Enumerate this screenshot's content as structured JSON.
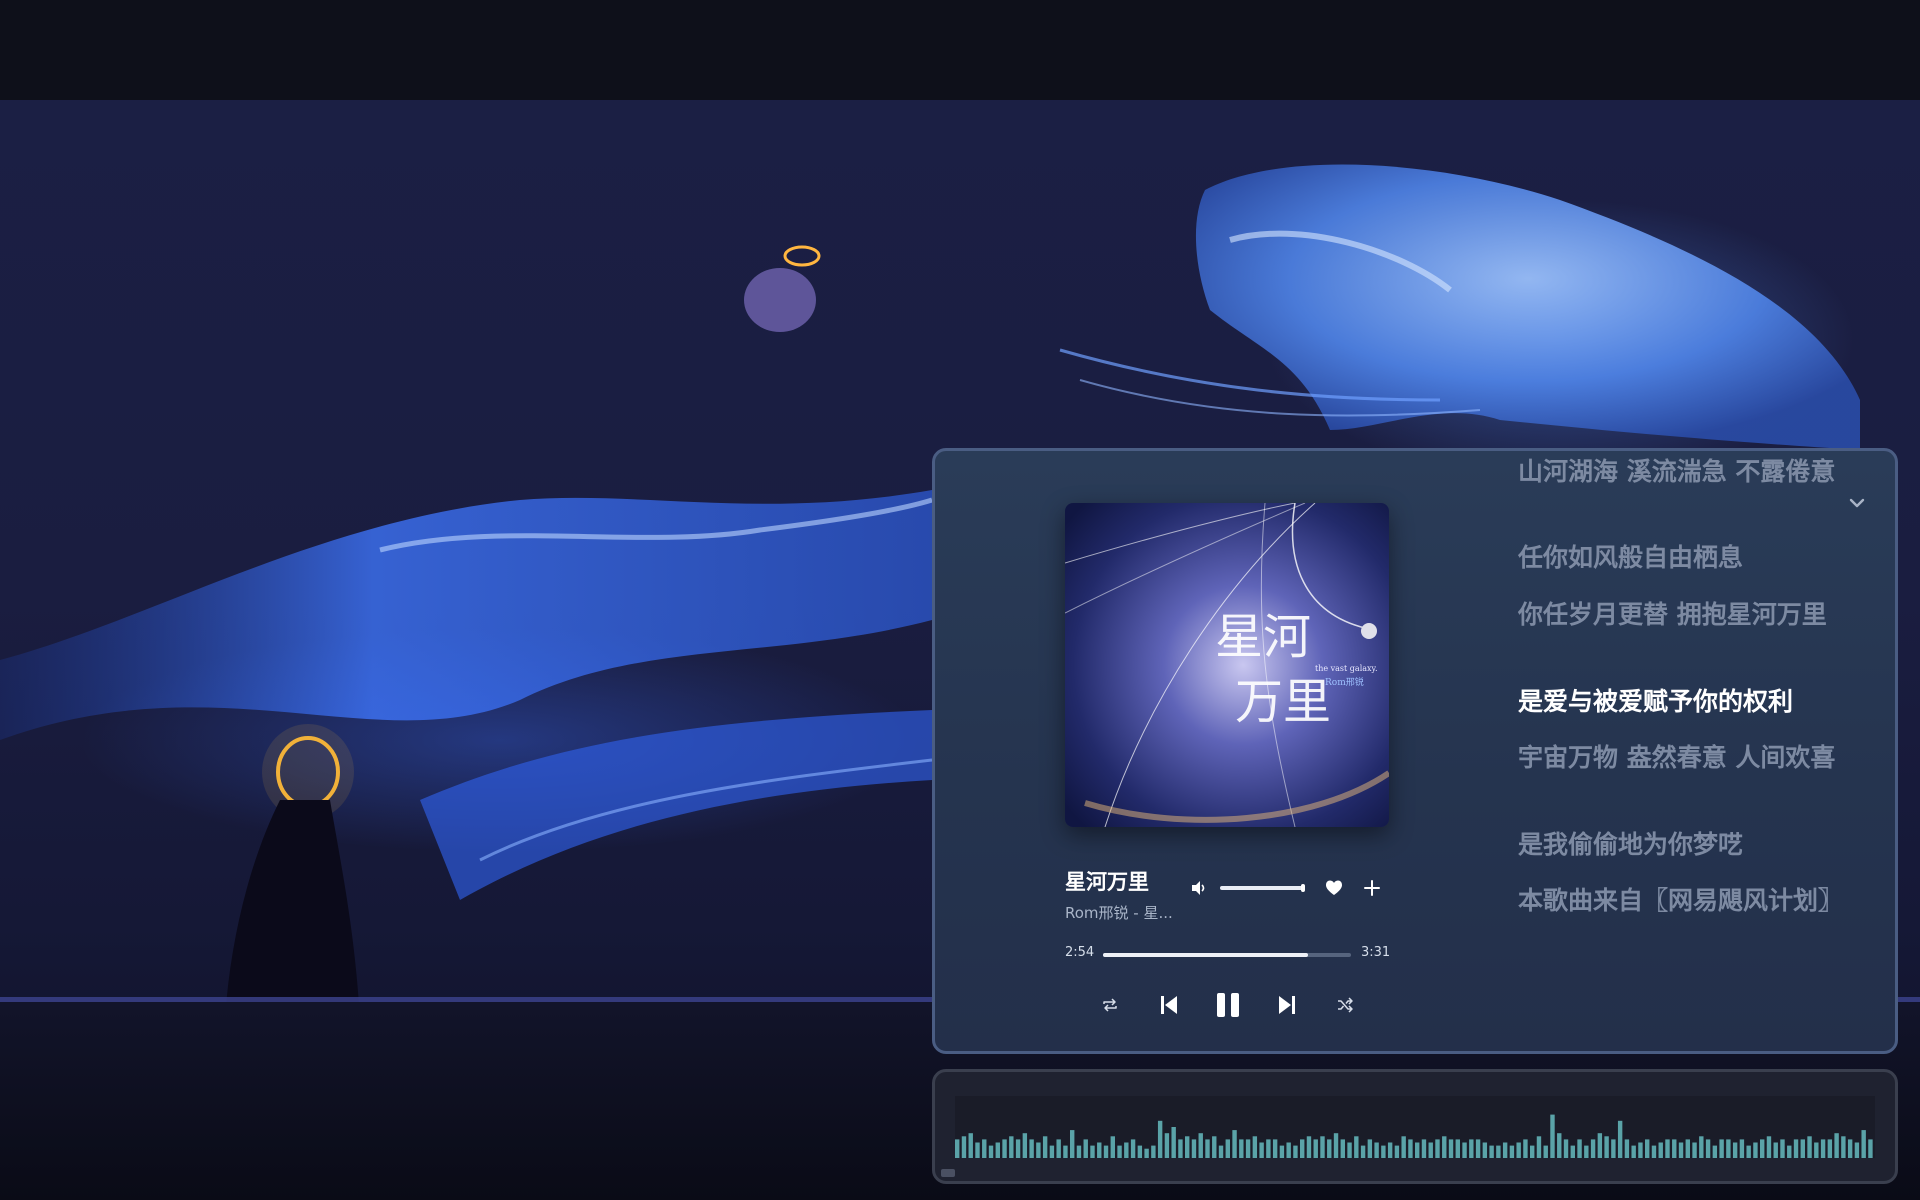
{
  "player": {
    "song_title": "星河万里",
    "song_artist": "Rom邢锐 - 星...",
    "time_current": "2:54",
    "time_total": "3:31",
    "progress": 0.825,
    "volume": 0.82,
    "cover_text": {
      "title_line1": "星河",
      "title_line2": "万里",
      "subtitle": "the vast galaxy.",
      "artist": "Rom邢锐"
    },
    "icons": {
      "volume": "volume-icon",
      "like": "heart-icon",
      "add": "plus-icon",
      "repeat": "repeat-icon",
      "previous": "skip-previous-icon",
      "play_pause": "pause-icon",
      "next": "skip-next-icon",
      "shuffle": "shuffle-icon",
      "collapse": "chevron-down-icon"
    }
  },
  "lyrics": {
    "active_index": 3,
    "lines": [
      "山河湖海 溪流湍急 不露倦意",
      "任你如风般自由栖息",
      "你任岁月更替 拥抱星河万里",
      "是爱与被爱赋予你的权利",
      "宇宙万物 盎然春意 人间欢喜",
      "是我偷偷地为你梦呓",
      "本歌曲来自〖网易飓风计划〗"
    ]
  },
  "visualizer": {
    "levels": [
      0.3,
      0.35,
      0.4,
      0.25,
      0.3,
      0.2,
      0.25,
      0.3,
      0.35,
      0.3,
      0.4,
      0.3,
      0.25,
      0.35,
      0.2,
      0.3,
      0.2,
      0.45,
      0.2,
      0.3,
      0.2,
      0.25,
      0.2,
      0.35,
      0.2,
      0.25,
      0.3,
      0.2,
      0.15,
      0.2,
      0.6,
      0.4,
      0.5,
      0.3,
      0.35,
      0.3,
      0.4,
      0.3,
      0.35,
      0.2,
      0.3,
      0.45,
      0.3,
      0.3,
      0.35,
      0.25,
      0.3,
      0.3,
      0.2,
      0.25,
      0.2,
      0.3,
      0.35,
      0.3,
      0.35,
      0.3,
      0.4,
      0.3,
      0.25,
      0.35,
      0.2,
      0.3,
      0.25,
      0.2,
      0.25,
      0.2,
      0.35,
      0.3,
      0.25,
      0.3,
      0.25,
      0.3,
      0.35,
      0.3,
      0.3,
      0.25,
      0.3,
      0.3,
      0.25,
      0.2,
      0.2,
      0.25,
      0.2,
      0.25,
      0.3,
      0.2,
      0.35,
      0.2,
      0.7,
      0.4,
      0.3,
      0.2,
      0.3,
      0.2,
      0.3,
      0.4,
      0.35,
      0.3,
      0.6,
      0.3,
      0.2,
      0.25,
      0.3,
      0.2,
      0.25,
      0.3,
      0.3,
      0.25,
      0.3,
      0.25,
      0.35,
      0.3,
      0.2,
      0.3,
      0.3,
      0.25,
      0.3,
      0.2,
      0.25,
      0.3,
      0.35,
      0.25,
      0.3,
      0.2,
      0.3,
      0.3,
      0.35,
      0.25,
      0.3,
      0.3,
      0.4,
      0.35,
      0.3,
      0.25,
      0.45,
      0.3
    ],
    "bar_color": "#5aa3a8"
  },
  "colors": {
    "panel_bg": "#2a3c58",
    "panel_border": "#4a5d83",
    "lyric_dim": "#7d8aa2",
    "lyric_active": "#ffffff"
  }
}
